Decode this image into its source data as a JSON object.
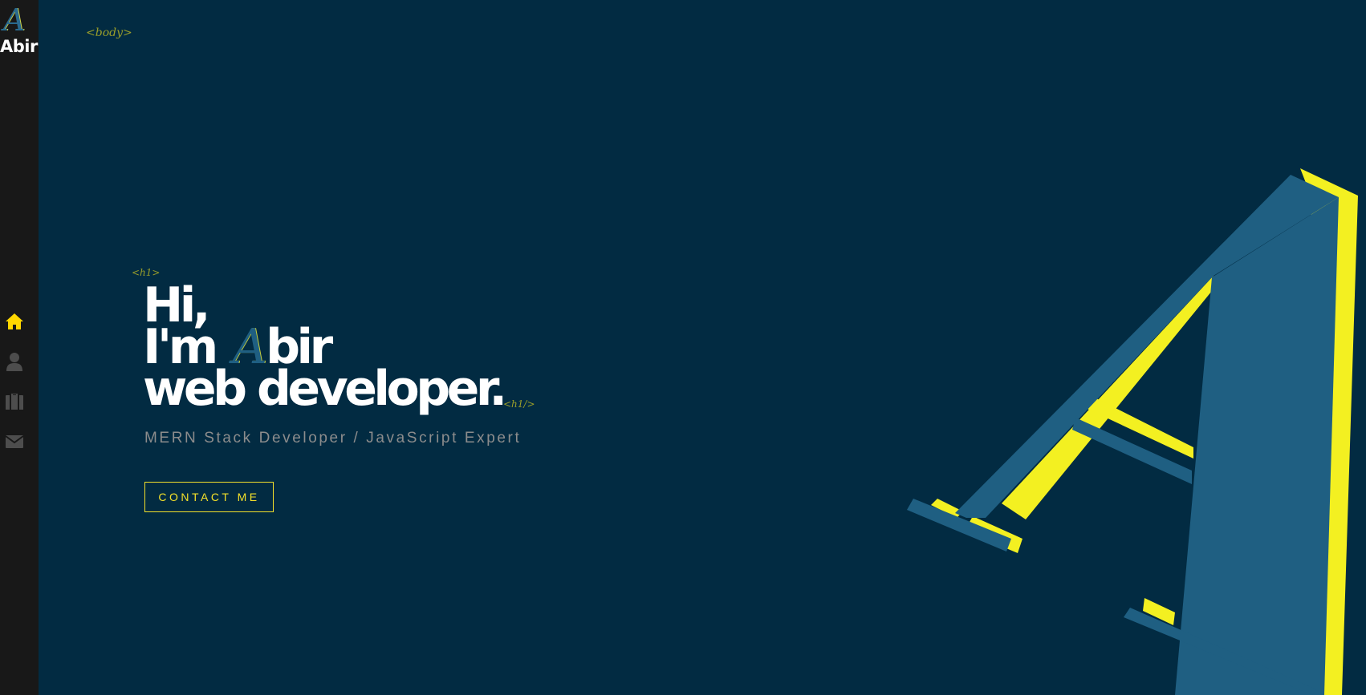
{
  "sidebar": {
    "logo_letter": "A",
    "logo_name": "Abir",
    "nav": [
      {
        "icon": "home-icon",
        "active": true
      },
      {
        "icon": "user-icon",
        "active": false
      },
      {
        "icon": "briefcase-icon",
        "active": false
      },
      {
        "icon": "envelope-icon",
        "active": false
      }
    ]
  },
  "tags": {
    "body": "<body>",
    "h1_open": "<h1>",
    "h1_close": "<h1/>"
  },
  "hero": {
    "line1": "Hi,",
    "line2_prefix": "I'm",
    "line2_letter": "A",
    "line2_suffix": "bir",
    "line3": "web developer.",
    "subtitle": "MERN Stack Developer / JavaScript Expert",
    "contact_label": "CONTACT ME"
  },
  "colors": {
    "background": "#022b42",
    "sidebar": "#181818",
    "accent_yellow": "#f3e02a",
    "accent_blue": "#1f5f82",
    "active_icon": "#ffd700",
    "inactive_icon": "#4d4d4d"
  }
}
